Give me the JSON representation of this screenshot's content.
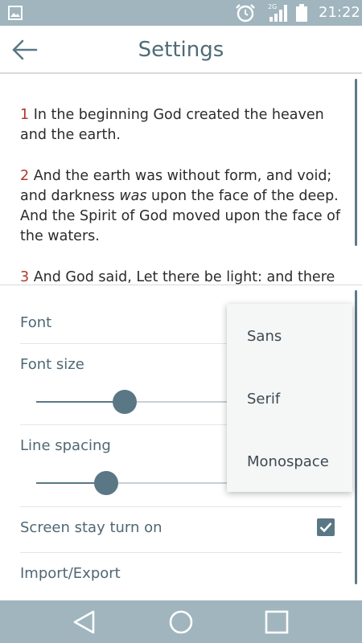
{
  "status_bar": {
    "time": "21:22",
    "network": "2G",
    "icons": [
      "image-icon",
      "alarm-icon",
      "signal-icon",
      "battery-icon"
    ]
  },
  "header": {
    "title": "Settings",
    "back_icon": "arrow-left-icon"
  },
  "preview": {
    "verses": [
      {
        "num": "1",
        "text": " In the beginning God created the heaven and the earth."
      },
      {
        "num": "2",
        "pre": " And the earth was without form, and void; and darkness ",
        "em": "was",
        "post": " upon the face of the deep. And the Spirit of God moved upon the face of the waters."
      },
      {
        "num": "3",
        "text": " And God said, Let there be light: and there"
      }
    ]
  },
  "settings": {
    "font_label": "Font",
    "font_size_label": "Font size",
    "font_size_value": 0.29,
    "line_spacing_label": "Line spacing",
    "line_spacing_value": 0.23,
    "screen_on_label": "Screen stay turn on",
    "screen_on_checked": true,
    "import_export_label": "Import/Export"
  },
  "font_menu": {
    "options": [
      "Sans",
      "Serif",
      "Monospace"
    ]
  },
  "nav_bar": {
    "icons": [
      "back-triangle-icon",
      "home-circle-icon",
      "recents-square-icon"
    ]
  },
  "colors": {
    "accent": "#5a7785",
    "verse_number": "#b0382b",
    "bars": "#a0b5bd"
  }
}
